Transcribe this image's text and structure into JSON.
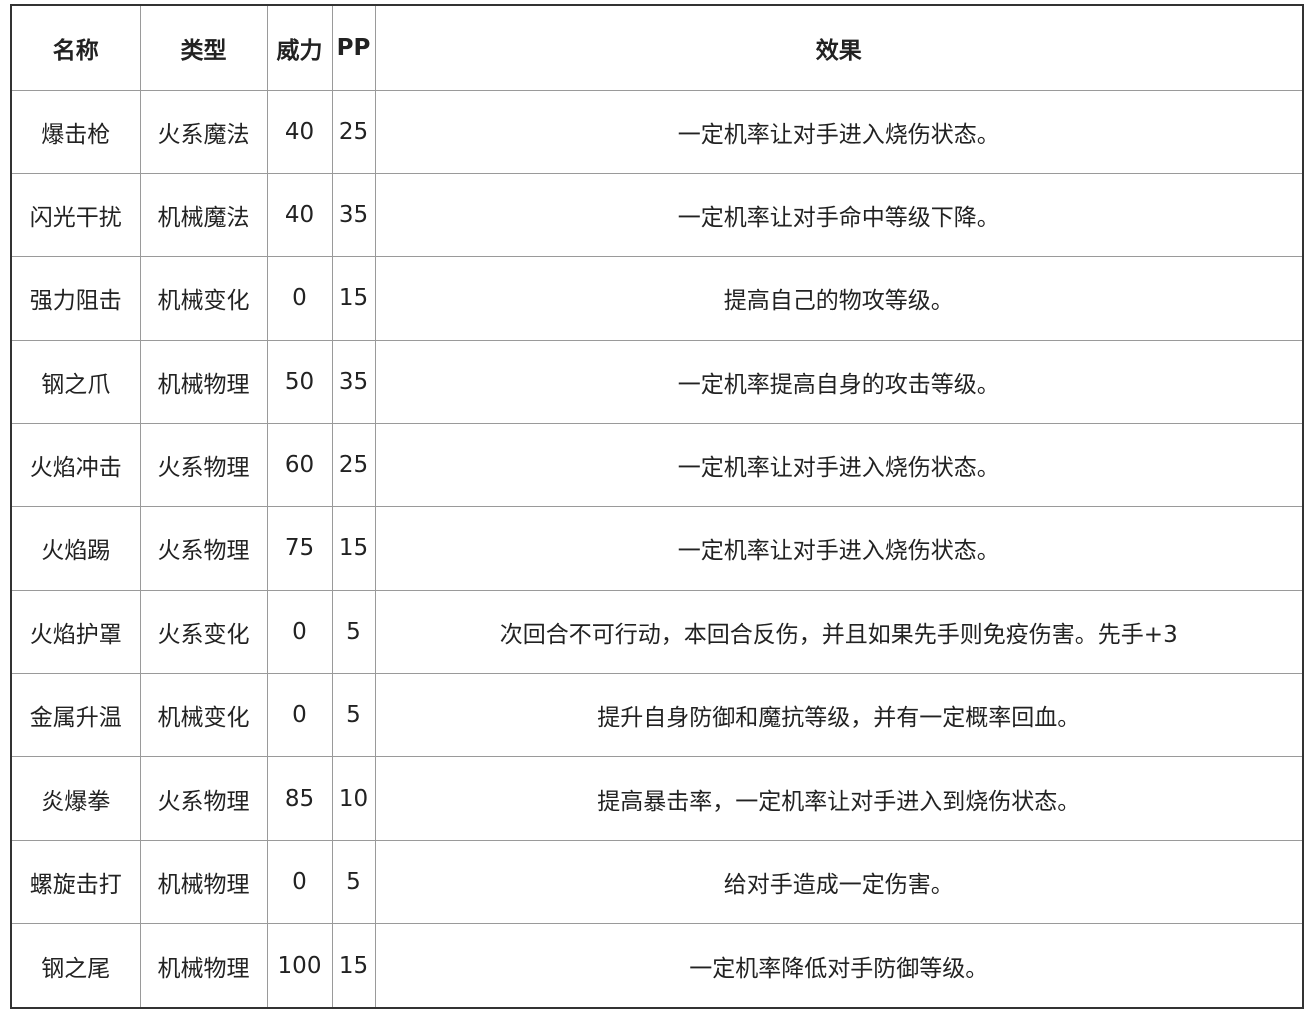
{
  "table": {
    "headers": {
      "name": "名称",
      "type": "类型",
      "power": "威力",
      "pp": "PP",
      "effect": "效果"
    },
    "rows": [
      {
        "name": "爆击枪",
        "type": "火系魔法",
        "power": "40",
        "pp": "25",
        "effect": "一定机率让对手进入烧伤状态。"
      },
      {
        "name": "闪光干扰",
        "type": "机械魔法",
        "power": "40",
        "pp": "35",
        "effect": "一定机率让对手命中等级下降。"
      },
      {
        "name": "强力阻击",
        "type": "机械变化",
        "power": "0",
        "pp": "15",
        "effect": "提高自己的物攻等级。"
      },
      {
        "name": "钢之爪",
        "type": "机械物理",
        "power": "50",
        "pp": "35",
        "effect": "一定机率提高自身的攻击等级。"
      },
      {
        "name": "火焰冲击",
        "type": "火系物理",
        "power": "60",
        "pp": "25",
        "effect": "一定机率让对手进入烧伤状态。"
      },
      {
        "name": "火焰踢",
        "type": "火系物理",
        "power": "75",
        "pp": "15",
        "effect": "一定机率让对手进入烧伤状态。"
      },
      {
        "name": "火焰护罩",
        "type": "火系变化",
        "power": "0",
        "pp": "5",
        "effect": "次回合不可行动，本回合反伤，并且如果先手则免疫伤害。先手+3"
      },
      {
        "name": "金属升温",
        "type": "机械变化",
        "power": "0",
        "pp": "5",
        "effect": "提升自身防御和魔抗等级，并有一定概率回血。"
      },
      {
        "name": "炎爆拳",
        "type": "火系物理",
        "power": "85",
        "pp": "10",
        "effect": "提高暴击率，一定机率让对手进入到烧伤状态。"
      },
      {
        "name": "螺旋击打",
        "type": "机械物理",
        "power": "0",
        "pp": "5",
        "effect": "给对手造成一定伤害。"
      },
      {
        "name": "钢之尾",
        "type": "机械物理",
        "power": "100",
        "pp": "15",
        "effect": "一定机率降低对手防御等级。"
      }
    ]
  }
}
